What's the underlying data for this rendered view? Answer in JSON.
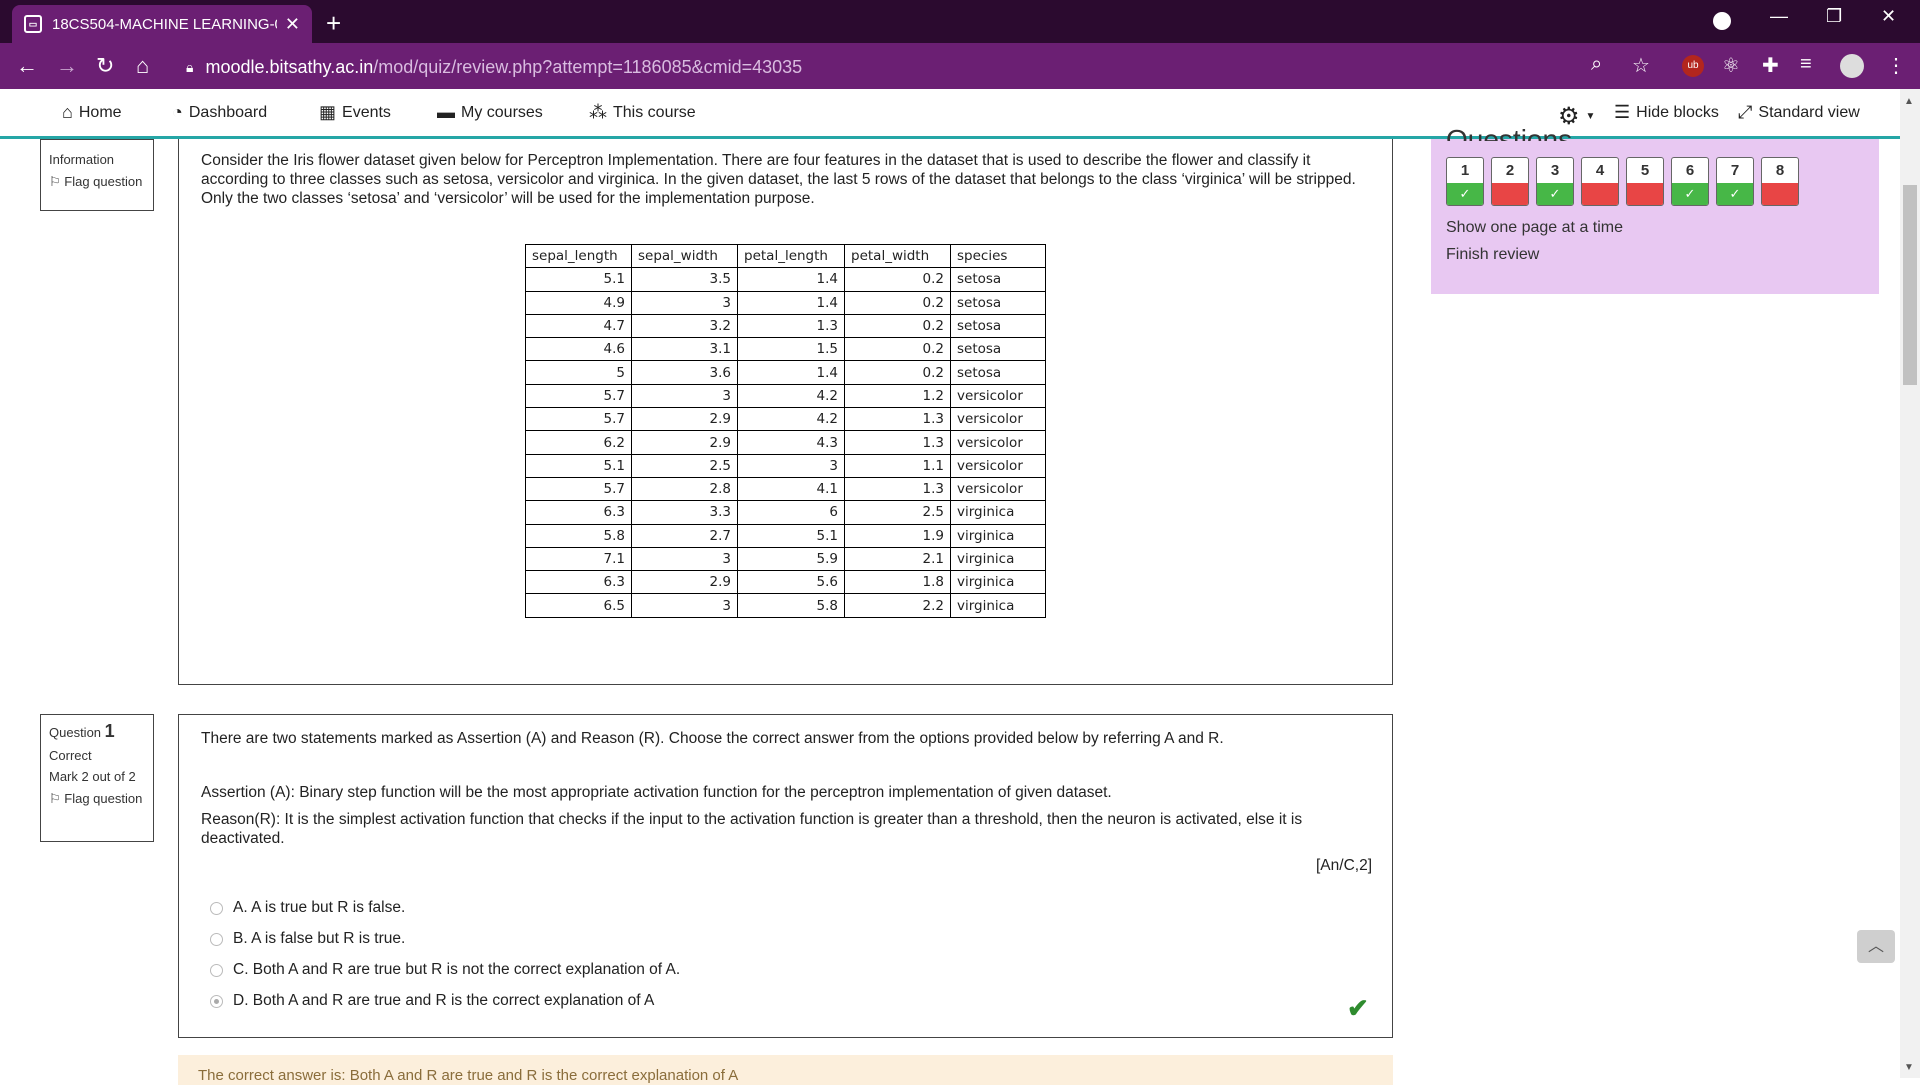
{
  "browser": {
    "tab_title": "18CS504-MACHINE LEARNING-0",
    "url_host": "moodle.bitsathy.ac.in",
    "url_path": "/mod/quiz/review.php?attempt=1186085&cmid=43035"
  },
  "nav": {
    "home": "Home",
    "dashboard": "Dashboard",
    "events": "Events",
    "my_courses": "My courses",
    "this_course": "This course",
    "hide_blocks": "Hide blocks",
    "standard_view": "Standard view"
  },
  "info_block": {
    "label": "Information",
    "flag": "Flag question"
  },
  "info_text": "Consider the Iris flower dataset given below for Perceptron Implementation. There are four features in the dataset that is used to describe the flower and classify it according to three classes such as setosa, versicolor and virginica. In the given dataset, the last 5 rows of the dataset that belongs to the class ‘virginica’ will be stripped. Only the two classes ‘setosa’ and ‘versicolor’ will be used for the implementation purpose.",
  "iris_table": {
    "headers": [
      "sepal_length",
      "sepal_width",
      "petal_length",
      "petal_width",
      "species"
    ],
    "rows": [
      [
        "5.1",
        "3.5",
        "1.4",
        "0.2",
        "setosa"
      ],
      [
        "4.9",
        "3",
        "1.4",
        "0.2",
        "setosa"
      ],
      [
        "4.7",
        "3.2",
        "1.3",
        "0.2",
        "setosa"
      ],
      [
        "4.6",
        "3.1",
        "1.5",
        "0.2",
        "setosa"
      ],
      [
        "5",
        "3.6",
        "1.4",
        "0.2",
        "setosa"
      ],
      [
        "5.7",
        "3",
        "4.2",
        "1.2",
        "versicolor"
      ],
      [
        "5.7",
        "2.9",
        "4.2",
        "1.3",
        "versicolor"
      ],
      [
        "6.2",
        "2.9",
        "4.3",
        "1.3",
        "versicolor"
      ],
      [
        "5.1",
        "2.5",
        "3",
        "1.1",
        "versicolor"
      ],
      [
        "5.7",
        "2.8",
        "4.1",
        "1.3",
        "versicolor"
      ],
      [
        "6.3",
        "3.3",
        "6",
        "2.5",
        "virginica"
      ],
      [
        "5.8",
        "2.7",
        "5.1",
        "1.9",
        "virginica"
      ],
      [
        "7.1",
        "3",
        "5.9",
        "2.1",
        "virginica"
      ],
      [
        "6.3",
        "2.9",
        "5.6",
        "1.8",
        "virginica"
      ],
      [
        "6.5",
        "3",
        "5.8",
        "2.2",
        "virginica"
      ]
    ]
  },
  "question1": {
    "label": "Question",
    "number": "1",
    "state": "Correct",
    "mark": "Mark 2 out of 2",
    "flag": "Flag question",
    "intro": "There are two statements marked as Assertion (A) and Reason (R). Choose the correct answer from the options provided below by referring A and R.",
    "assertion": "Assertion (A): Binary step function will be the most appropriate activation function for the perceptron implementation of given dataset.",
    "reason": "Reason(R): It is the simplest activation function that checks if the input to the activation function is greater than a threshold, then the neuron is activated, else it is deactivated.",
    "tag": "[An/C,2]",
    "options": [
      {
        "text": "A. A is true but R is false.",
        "selected": false
      },
      {
        "text": "B. A is false but R is true.",
        "selected": false
      },
      {
        "text": "C. Both A and R are true but R is not the correct explanation of A.",
        "selected": false
      },
      {
        "text": "D. Both A and R are true and R is the correct explanation of A",
        "selected": true
      }
    ],
    "feedback": "The correct answer is: Both A and R are true and R is the correct explanation of A"
  },
  "quiz_nav": {
    "title": "Questions",
    "buttons": [
      {
        "n": "1",
        "state": "correct"
      },
      {
        "n": "2",
        "state": "incorrect"
      },
      {
        "n": "3",
        "state": "correct"
      },
      {
        "n": "4",
        "state": "incorrect"
      },
      {
        "n": "5",
        "state": "incorrect"
      },
      {
        "n": "6",
        "state": "correct"
      },
      {
        "n": "7",
        "state": "correct"
      },
      {
        "n": "8",
        "state": "incorrect"
      }
    ],
    "show_one_page": "Show one page at a time",
    "finish_review": "Finish review"
  }
}
